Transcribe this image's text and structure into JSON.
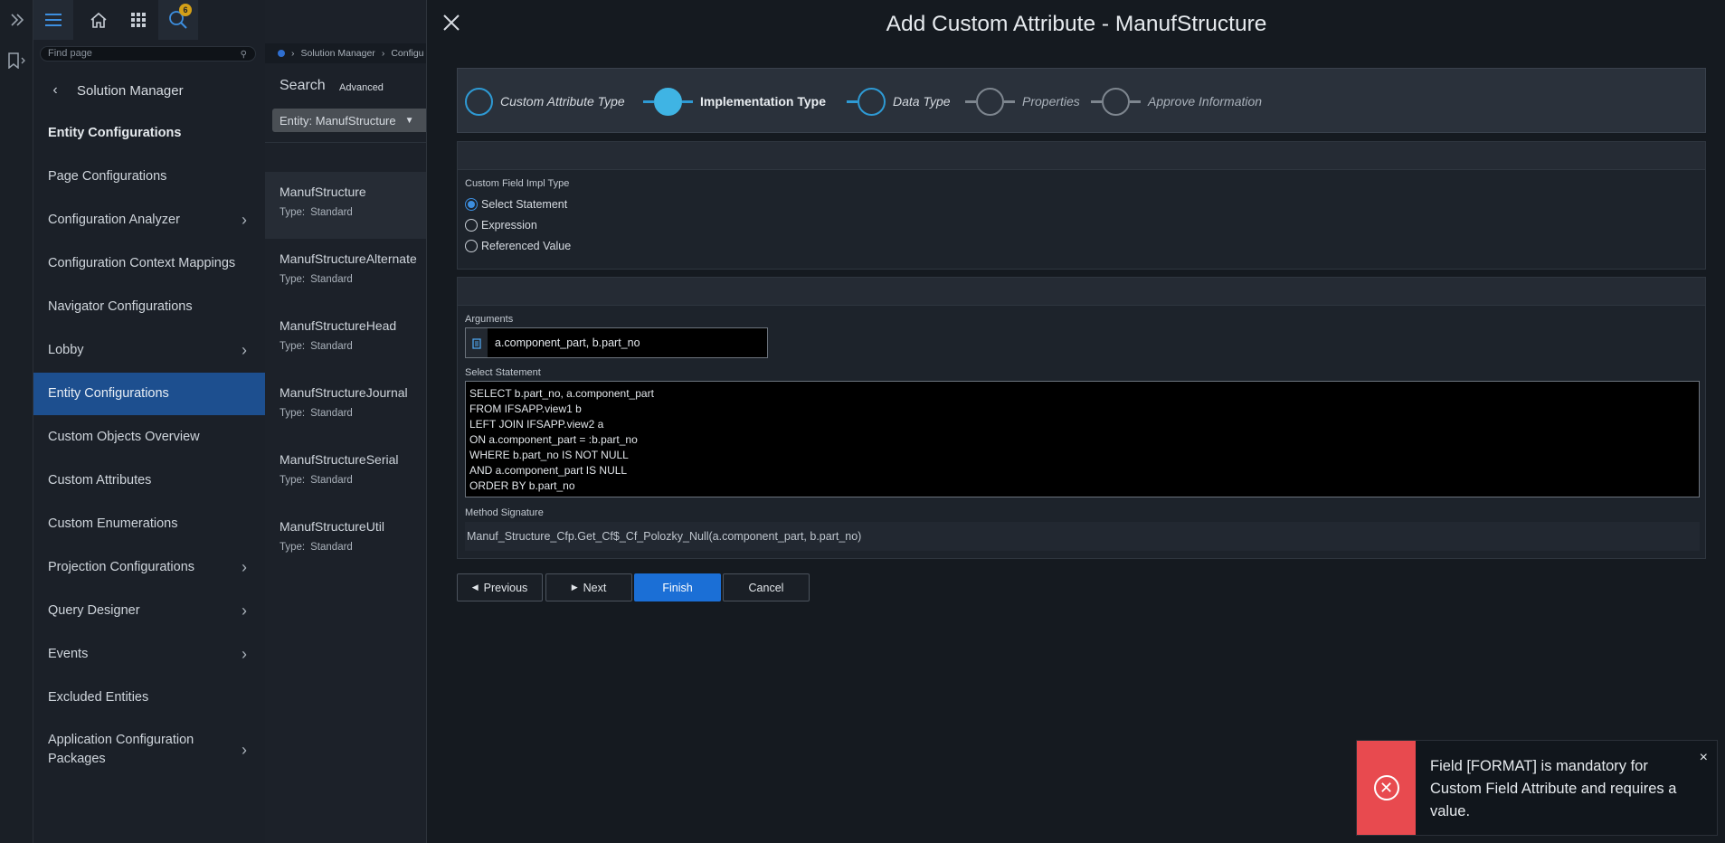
{
  "rail": {
    "expand_icon": "double-chevron-right-icon",
    "bookmark_icon": "bookmark-icon"
  },
  "topbar": {
    "notification_count": "6"
  },
  "nav": {
    "find_placeholder": "Find page",
    "header": "Solution Manager",
    "items": [
      {
        "label": "Entity Configurations",
        "bold": true
      },
      {
        "label": "Page Configurations"
      },
      {
        "label": "Configuration Analyzer",
        "chevron": true
      },
      {
        "label": "Configuration Context Mappings"
      },
      {
        "label": "Navigator Configurations"
      },
      {
        "label": "Lobby",
        "chevron": true
      },
      {
        "label": "Entity Configurations",
        "selected": true
      },
      {
        "label": "Custom Objects Overview"
      },
      {
        "label": "Custom Attributes"
      },
      {
        "label": "Custom Enumerations"
      },
      {
        "label": "Projection Configurations",
        "chevron": true
      },
      {
        "label": "Query Designer",
        "chevron": true
      },
      {
        "label": "Events",
        "chevron": true
      },
      {
        "label": "Excluded Entities"
      },
      {
        "label": "Application Configuration Packages",
        "chevron": true
      }
    ]
  },
  "list": {
    "breadcrumb": [
      "Solution Manager",
      "Configu"
    ],
    "search_label": "Search",
    "advanced_label": "Advanced",
    "entity_filter": "Entity: ManufStructure",
    "type_label": "Type:",
    "entities": [
      {
        "name": "ManufStructure",
        "type": "Standard"
      },
      {
        "name": "ManufStructureAlternate",
        "type": "Standard"
      },
      {
        "name": "ManufStructureHead",
        "type": "Standard"
      },
      {
        "name": "ManufStructureJournal",
        "type": "Standard"
      },
      {
        "name": "ManufStructureSerial",
        "type": "Standard"
      },
      {
        "name": "ManufStructureUtil",
        "type": "Standard"
      }
    ]
  },
  "dialog": {
    "title": "Add Custom Attribute - ManufStructure",
    "steps": [
      "Custom Attribute Type",
      "Implementation Type",
      "Data Type",
      "Properties",
      "Approve Information"
    ],
    "impl_type_label": "Custom Field Impl Type",
    "impl_options": [
      "Select Statement",
      "Expression",
      "Referenced Value"
    ],
    "arguments_label": "Arguments",
    "arguments_value": "a.component_part, b.part_no",
    "select_label": "Select Statement",
    "sql_lines": [
      "SELECT b.part_no, a.component_part",
      "FROM IFSAPP.view1 b",
      "LEFT JOIN IFSAPP.view2 a",
      "ON a.component_part = :b.part_no",
      "WHERE b.part_no IS NOT NULL",
      "AND a.component_part IS NULL",
      "ORDER BY b.part_no"
    ],
    "method_label": "Method Signature",
    "method_value": "Manuf_Structure_Cfp.Get_Cf$_Cf_Polozky_Null(a.component_part, b.part_no)",
    "buttons": {
      "previous": "Previous",
      "next": "Next",
      "finish": "Finish",
      "cancel": "Cancel"
    }
  },
  "toast": {
    "message": "Field [FORMAT] is mandatory for Custom Field Attribute and requires a value.",
    "close": "×"
  },
  "colors": {
    "accent": "#1b6fd6",
    "selected_nav": "#1d4f8f",
    "step_active": "#3fb4e4",
    "error": "#e84a4f"
  }
}
